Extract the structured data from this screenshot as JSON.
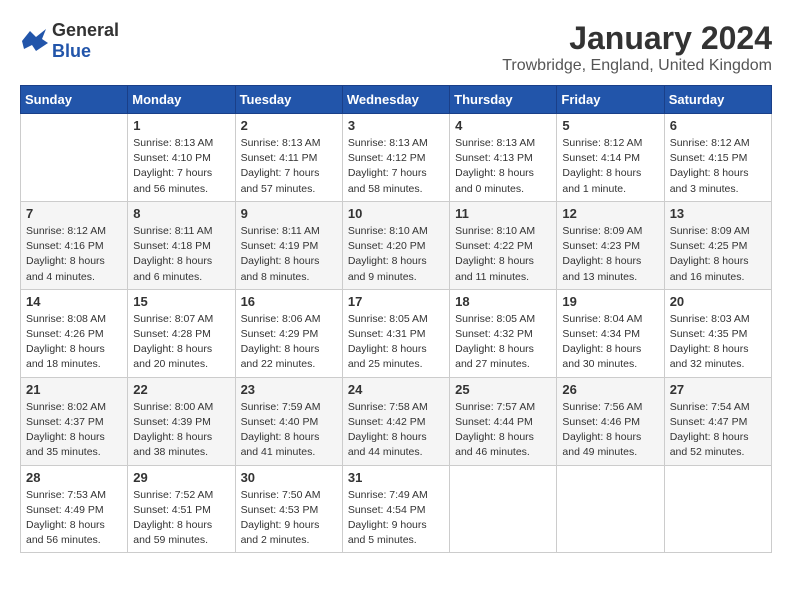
{
  "header": {
    "logo_general": "General",
    "logo_blue": "Blue",
    "title": "January 2024",
    "location": "Trowbridge, England, United Kingdom"
  },
  "calendar": {
    "days_of_week": [
      "Sunday",
      "Monday",
      "Tuesday",
      "Wednesday",
      "Thursday",
      "Friday",
      "Saturday"
    ],
    "weeks": [
      [
        {
          "day": "",
          "sunrise": "",
          "sunset": "",
          "daylight": ""
        },
        {
          "day": "1",
          "sunrise": "Sunrise: 8:13 AM",
          "sunset": "Sunset: 4:10 PM",
          "daylight": "Daylight: 7 hours and 56 minutes."
        },
        {
          "day": "2",
          "sunrise": "Sunrise: 8:13 AM",
          "sunset": "Sunset: 4:11 PM",
          "daylight": "Daylight: 7 hours and 57 minutes."
        },
        {
          "day": "3",
          "sunrise": "Sunrise: 8:13 AM",
          "sunset": "Sunset: 4:12 PM",
          "daylight": "Daylight: 7 hours and 58 minutes."
        },
        {
          "day": "4",
          "sunrise": "Sunrise: 8:13 AM",
          "sunset": "Sunset: 4:13 PM",
          "daylight": "Daylight: 8 hours and 0 minutes."
        },
        {
          "day": "5",
          "sunrise": "Sunrise: 8:12 AM",
          "sunset": "Sunset: 4:14 PM",
          "daylight": "Daylight: 8 hours and 1 minute."
        },
        {
          "day": "6",
          "sunrise": "Sunrise: 8:12 AM",
          "sunset": "Sunset: 4:15 PM",
          "daylight": "Daylight: 8 hours and 3 minutes."
        }
      ],
      [
        {
          "day": "7",
          "sunrise": "Sunrise: 8:12 AM",
          "sunset": "Sunset: 4:16 PM",
          "daylight": "Daylight: 8 hours and 4 minutes."
        },
        {
          "day": "8",
          "sunrise": "Sunrise: 8:11 AM",
          "sunset": "Sunset: 4:18 PM",
          "daylight": "Daylight: 8 hours and 6 minutes."
        },
        {
          "day": "9",
          "sunrise": "Sunrise: 8:11 AM",
          "sunset": "Sunset: 4:19 PM",
          "daylight": "Daylight: 8 hours and 8 minutes."
        },
        {
          "day": "10",
          "sunrise": "Sunrise: 8:10 AM",
          "sunset": "Sunset: 4:20 PM",
          "daylight": "Daylight: 8 hours and 9 minutes."
        },
        {
          "day": "11",
          "sunrise": "Sunrise: 8:10 AM",
          "sunset": "Sunset: 4:22 PM",
          "daylight": "Daylight: 8 hours and 11 minutes."
        },
        {
          "day": "12",
          "sunrise": "Sunrise: 8:09 AM",
          "sunset": "Sunset: 4:23 PM",
          "daylight": "Daylight: 8 hours and 13 minutes."
        },
        {
          "day": "13",
          "sunrise": "Sunrise: 8:09 AM",
          "sunset": "Sunset: 4:25 PM",
          "daylight": "Daylight: 8 hours and 16 minutes."
        }
      ],
      [
        {
          "day": "14",
          "sunrise": "Sunrise: 8:08 AM",
          "sunset": "Sunset: 4:26 PM",
          "daylight": "Daylight: 8 hours and 18 minutes."
        },
        {
          "day": "15",
          "sunrise": "Sunrise: 8:07 AM",
          "sunset": "Sunset: 4:28 PM",
          "daylight": "Daylight: 8 hours and 20 minutes."
        },
        {
          "day": "16",
          "sunrise": "Sunrise: 8:06 AM",
          "sunset": "Sunset: 4:29 PM",
          "daylight": "Daylight: 8 hours and 22 minutes."
        },
        {
          "day": "17",
          "sunrise": "Sunrise: 8:05 AM",
          "sunset": "Sunset: 4:31 PM",
          "daylight": "Daylight: 8 hours and 25 minutes."
        },
        {
          "day": "18",
          "sunrise": "Sunrise: 8:05 AM",
          "sunset": "Sunset: 4:32 PM",
          "daylight": "Daylight: 8 hours and 27 minutes."
        },
        {
          "day": "19",
          "sunrise": "Sunrise: 8:04 AM",
          "sunset": "Sunset: 4:34 PM",
          "daylight": "Daylight: 8 hours and 30 minutes."
        },
        {
          "day": "20",
          "sunrise": "Sunrise: 8:03 AM",
          "sunset": "Sunset: 4:35 PM",
          "daylight": "Daylight: 8 hours and 32 minutes."
        }
      ],
      [
        {
          "day": "21",
          "sunrise": "Sunrise: 8:02 AM",
          "sunset": "Sunset: 4:37 PM",
          "daylight": "Daylight: 8 hours and 35 minutes."
        },
        {
          "day": "22",
          "sunrise": "Sunrise: 8:00 AM",
          "sunset": "Sunset: 4:39 PM",
          "daylight": "Daylight: 8 hours and 38 minutes."
        },
        {
          "day": "23",
          "sunrise": "Sunrise: 7:59 AM",
          "sunset": "Sunset: 4:40 PM",
          "daylight": "Daylight: 8 hours and 41 minutes."
        },
        {
          "day": "24",
          "sunrise": "Sunrise: 7:58 AM",
          "sunset": "Sunset: 4:42 PM",
          "daylight": "Daylight: 8 hours and 44 minutes."
        },
        {
          "day": "25",
          "sunrise": "Sunrise: 7:57 AM",
          "sunset": "Sunset: 4:44 PM",
          "daylight": "Daylight: 8 hours and 46 minutes."
        },
        {
          "day": "26",
          "sunrise": "Sunrise: 7:56 AM",
          "sunset": "Sunset: 4:46 PM",
          "daylight": "Daylight: 8 hours and 49 minutes."
        },
        {
          "day": "27",
          "sunrise": "Sunrise: 7:54 AM",
          "sunset": "Sunset: 4:47 PM",
          "daylight": "Daylight: 8 hours and 52 minutes."
        }
      ],
      [
        {
          "day": "28",
          "sunrise": "Sunrise: 7:53 AM",
          "sunset": "Sunset: 4:49 PM",
          "daylight": "Daylight: 8 hours and 56 minutes."
        },
        {
          "day": "29",
          "sunrise": "Sunrise: 7:52 AM",
          "sunset": "Sunset: 4:51 PM",
          "daylight": "Daylight: 8 hours and 59 minutes."
        },
        {
          "day": "30",
          "sunrise": "Sunrise: 7:50 AM",
          "sunset": "Sunset: 4:53 PM",
          "daylight": "Daylight: 9 hours and 2 minutes."
        },
        {
          "day": "31",
          "sunrise": "Sunrise: 7:49 AM",
          "sunset": "Sunset: 4:54 PM",
          "daylight": "Daylight: 9 hours and 5 minutes."
        },
        {
          "day": "",
          "sunrise": "",
          "sunset": "",
          "daylight": ""
        },
        {
          "day": "",
          "sunrise": "",
          "sunset": "",
          "daylight": ""
        },
        {
          "day": "",
          "sunrise": "",
          "sunset": "",
          "daylight": ""
        }
      ]
    ]
  }
}
